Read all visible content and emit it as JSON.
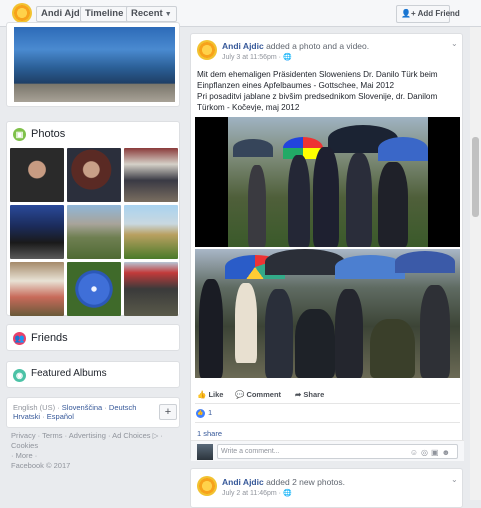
{
  "topbar": {
    "name": "Andi Ajdic",
    "timeline_label": "Timeline",
    "recent_label": "Recent",
    "add_friend_label": "Add Friend"
  },
  "left": {
    "photos_title": "Photos",
    "friends_title": "Friends",
    "albums_title": "Featured Albums",
    "languages": {
      "current": "English (US)",
      "sep1": " · ",
      "lang1": "Slovenščina",
      "sep2": " · ",
      "lang2": "Deutsch",
      "lang3": "Hrvatski",
      "sep3": " · ",
      "lang4": "Español"
    },
    "footer": {
      "line1": "Privacy · Terms · Advertising · Ad Choices ▷ · Cookies",
      "line2": "· More ·",
      "line3": "Facebook © 2017"
    }
  },
  "post": {
    "author": "Andi Ajdic",
    "action": " added a photo and a video.",
    "date": "July 3 at 11:56pm · 🌐",
    "text_de": "Mit dem ehemaligen Präsidenten Sloweniens Dr. Danilo Türk beim Einpflanzen eines Apfelbaumes - Gottschee, Mai 2012",
    "text_sl": "Pri posaditvi jablane z bivšim predsednikom Slovenije, dr. Danilom Türkom - Kočevje, maj 2012",
    "like_label": "Like",
    "comment_label": "Comment",
    "share_label": "Share",
    "like_count": "1",
    "share_count": "1 share",
    "comment_placeholder": "Write a comment..."
  },
  "post2": {
    "author": "Andi Ajdic",
    "action": " added 2 new photos.",
    "date": "July 2 at 11:46pm · 🌐"
  }
}
